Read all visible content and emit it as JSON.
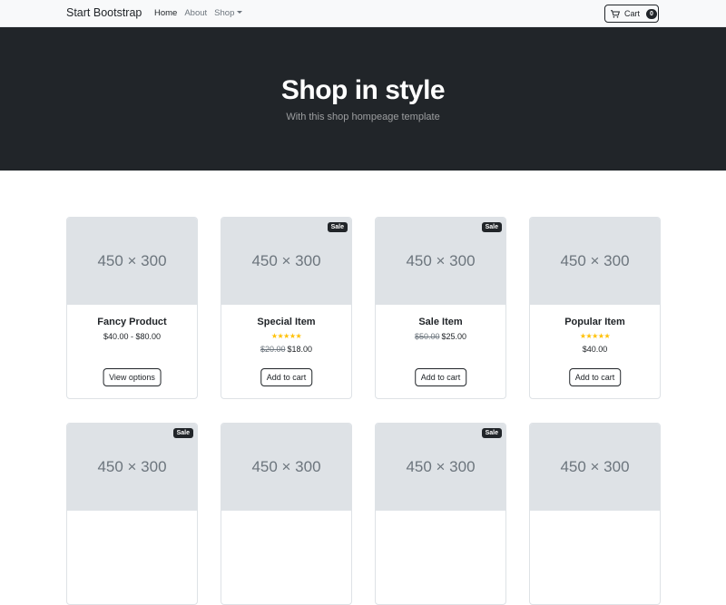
{
  "navbar": {
    "brand": "Start Bootstrap",
    "links": [
      {
        "label": "Home"
      },
      {
        "label": "About"
      },
      {
        "label": "Shop"
      }
    ],
    "cart": {
      "label": "Cart",
      "count": "0"
    }
  },
  "hero": {
    "title": "Shop in style",
    "subtitle": "With this shop hompeage template"
  },
  "products": [
    {
      "image": "450 × 300",
      "badge": "",
      "name": "Fancy Product",
      "rating": 0,
      "old_price": "",
      "price": "$40.00 - $80.00",
      "button": "View options"
    },
    {
      "image": "450 × 300",
      "badge": "Sale",
      "name": "Special Item",
      "rating": 5,
      "old_price": "$20.00",
      "price": "$18.00",
      "button": "Add to cart"
    },
    {
      "image": "450 × 300",
      "badge": "Sale",
      "name": "Sale Item",
      "rating": 0,
      "old_price": "$50.00",
      "price": "$25.00",
      "button": "Add to cart"
    },
    {
      "image": "450 × 300",
      "badge": "",
      "name": "Popular Item",
      "rating": 5,
      "old_price": "",
      "price": "$40.00",
      "button": "Add to cart"
    },
    {
      "image": "450 × 300",
      "badge": "Sale",
      "name": "",
      "rating": 0,
      "old_price": "",
      "price": "",
      "button": ""
    },
    {
      "image": "450 × 300",
      "badge": "",
      "name": "",
      "rating": 0,
      "old_price": "",
      "price": "",
      "button": ""
    },
    {
      "image": "450 × 300",
      "badge": "Sale",
      "name": "",
      "rating": 0,
      "old_price": "",
      "price": "",
      "button": ""
    },
    {
      "image": "450 × 300",
      "badge": "",
      "name": "",
      "rating": 0,
      "old_price": "",
      "price": "",
      "button": ""
    }
  ],
  "colors": {
    "dark": "#212529",
    "light": "#f8f9fa",
    "placeholder": "#dee2e6",
    "star": "#ffc107"
  },
  "icons": {
    "cart": "cart-icon",
    "star": "star-icon",
    "dropdown": "caret-down-icon"
  }
}
